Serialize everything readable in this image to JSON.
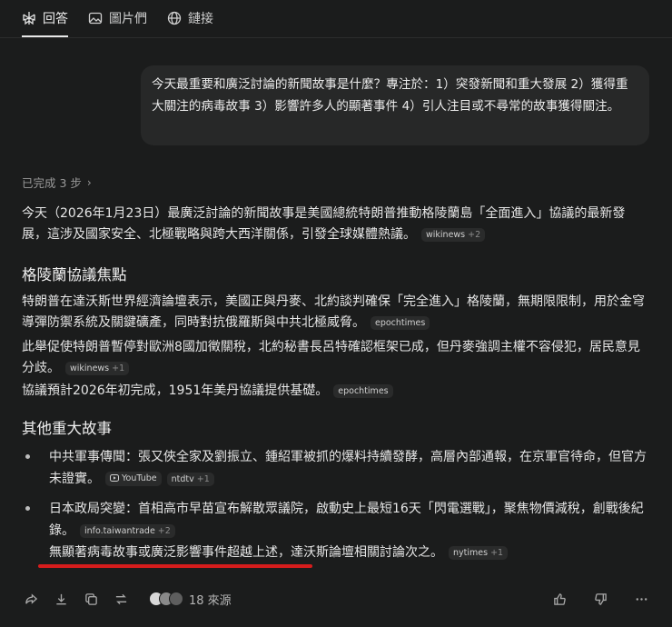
{
  "tabs": [
    {
      "label": "回答",
      "icon": "perplexity-logo-icon"
    },
    {
      "label": "圖片們",
      "icon": "image-icon"
    },
    {
      "label": "鏈接",
      "icon": "globe-icon"
    }
  ],
  "query": "今天最重要和廣泛討論的新聞故事是什麼？專注於：1）突發新聞和重大發展 2）獲得重大關注的病毒故事 3）影響許多人的顯著事件 4）引人注目或不尋常的故事獲得關注。",
  "steps_label": "已完成 3 步",
  "intro": {
    "text": "今天（2026年1月23日）最廣泛討論的新聞故事是美國總統特朗普推動格陵蘭島「全面進入」協議的最新發展，這涉及國家安全、北極戰略與跨大西洋關係，引發全球媒體熱議。",
    "cite": "wikinews",
    "cite_more": "+2"
  },
  "section1": {
    "heading": "格陵蘭協議焦點",
    "p1": {
      "text": "特朗普在達沃斯世界經濟論壇表示，美國正與丹麥、北約談判確保「完全進入」格陵蘭，無期限限制，用於金穹導彈防禦系統及關鍵礦產，同時對抗俄羅斯與中共北極威脅。",
      "cite": "epochtimes"
    },
    "p2": {
      "text": "此舉促使特朗普暫停對歐洲8國加徵關稅，北約秘書長呂特確認框架已成，但丹麥強調主權不容侵犯，居民意見分歧。",
      "cite": "wikinews",
      "cite_more": "+1"
    },
    "p3": {
      "text": "協議預計2026年初完成，1951年美丹協議提供基礎。",
      "cite": "epochtimes"
    }
  },
  "section2": {
    "heading": "其他重大故事",
    "b1": {
      "text": "中共軍事傳聞：張又俠全家及劉振立、鍾紹軍被抓的爆料持續發酵，高層內部通報，在京軍官待命，但官方未證實。",
      "cite_yt": "YouTube",
      "cite2": "ntdtv",
      "cite2_more": "+1"
    },
    "b2": {
      "text": "日本政局突變：首相高市早苗宣布解散眾議院，啟動史上最短16天「閃電選戰」，聚焦物價減稅，創戰後紀錄。",
      "cite": "info.taiwantrade",
      "cite_more": "+2"
    },
    "b3": {
      "text": "無顯著病毒故事或廣泛影響事件超越上述，達沃斯論壇相關討論次之。",
      "cite": "nytimes",
      "cite_more": "+1"
    }
  },
  "sources": {
    "label": "18 來源",
    "colors": [
      "#d8d8d8",
      "#8a8a8a",
      "#5e5e5e"
    ]
  },
  "accent": "#d61c1c"
}
